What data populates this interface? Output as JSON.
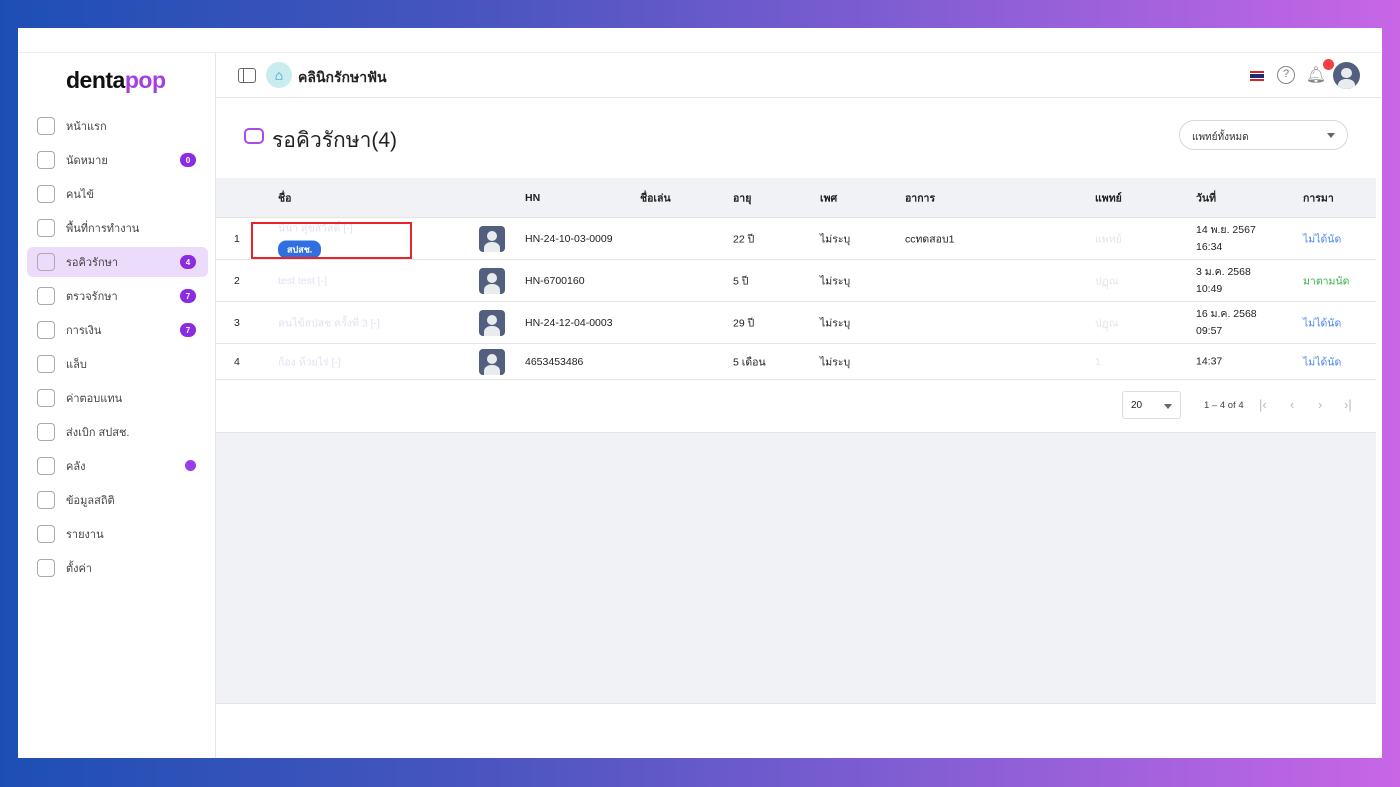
{
  "brand": {
    "name_a": "denta",
    "name_b": "pop"
  },
  "sidebar": {
    "items": [
      {
        "label": "หน้าแรก"
      },
      {
        "label": "นัดหมาย",
        "badge": "0"
      },
      {
        "label": "คนไข้"
      },
      {
        "label": "พื้นที่การทำงาน"
      },
      {
        "label": "รอคิวรักษา",
        "badge": "4",
        "active": true
      },
      {
        "label": "ตรวจรักษา",
        "badge": "7"
      },
      {
        "label": "การเงิน",
        "badge": "7"
      },
      {
        "label": "แล็บ"
      },
      {
        "label": "ค่าตอบแทน"
      },
      {
        "label": "ส่งเบิก สปสช."
      },
      {
        "label": "คลัง",
        "dot": true
      },
      {
        "label": "ข้อมูลสถิติ"
      },
      {
        "label": "รายงาน"
      },
      {
        "label": "ตั้งค่า"
      }
    ]
  },
  "header": {
    "clinic": "คลินิกรักษาฟัน",
    "help": "?"
  },
  "page": {
    "title": "รอคิวรักษา(4)",
    "doctor_filter": "แพทย์ทั้งหมด"
  },
  "table": {
    "columns": {
      "name": "ชื่อ",
      "hn": "HN",
      "nickname": "ชื่อเล่น",
      "age": "อายุ",
      "sex": "เพศ",
      "symptom": "อาการ",
      "doctor": "แพทย์",
      "date": "วันที่",
      "status": "การมา"
    },
    "rows": [
      {
        "no": "1",
        "name": "นินา สุขสวัสดิ์ [-]",
        "tag": "สปสช.",
        "hn": "HN-24-10-03-0009",
        "age": "22 ปี",
        "sex": "ไม่ระบุ",
        "symptom": "ccทดสอบ1",
        "doctor": "แพทย์",
        "date": "14 พ.ย. 2567",
        "time": "16:34",
        "status": "ไม่ได้นัด",
        "status_color": "#4f86f0"
      },
      {
        "no": "2",
        "name": "test test [-]",
        "hn": "HN-6700160",
        "age": "5 ปี",
        "sex": "ไม่ระบุ",
        "symptom": "",
        "doctor": "ปฏุณ",
        "date": "3 ม.ค. 2568",
        "time": "10:49",
        "status": "มาตามนัด",
        "status_color": "#3bb34a"
      },
      {
        "no": "3",
        "name": "คนไข้สปสช ครั้งที่ 3 [-]",
        "hn": "HN-24-12-04-0003",
        "age": "29 ปี",
        "sex": "ไม่ระบุ",
        "symptom": "",
        "doctor": "ปฏุณ",
        "date": "16 ม.ค. 2568",
        "time": "09:57",
        "status": "ไม่ได้นัด",
        "status_color": "#4f86f0"
      },
      {
        "no": "4",
        "name": "ก้อง ห้วยไร่ [-]",
        "hn": "4653453486",
        "age": "5 เดือน",
        "sex": "ไม่ระบุ",
        "symptom": "",
        "doctor": "1",
        "date": "",
        "time": "14:37",
        "status": "ไม่ได้นัด",
        "status_color": "#4f86f0"
      }
    ]
  },
  "pagination": {
    "per_page": "20",
    "range": "1 – 4 of 4"
  }
}
